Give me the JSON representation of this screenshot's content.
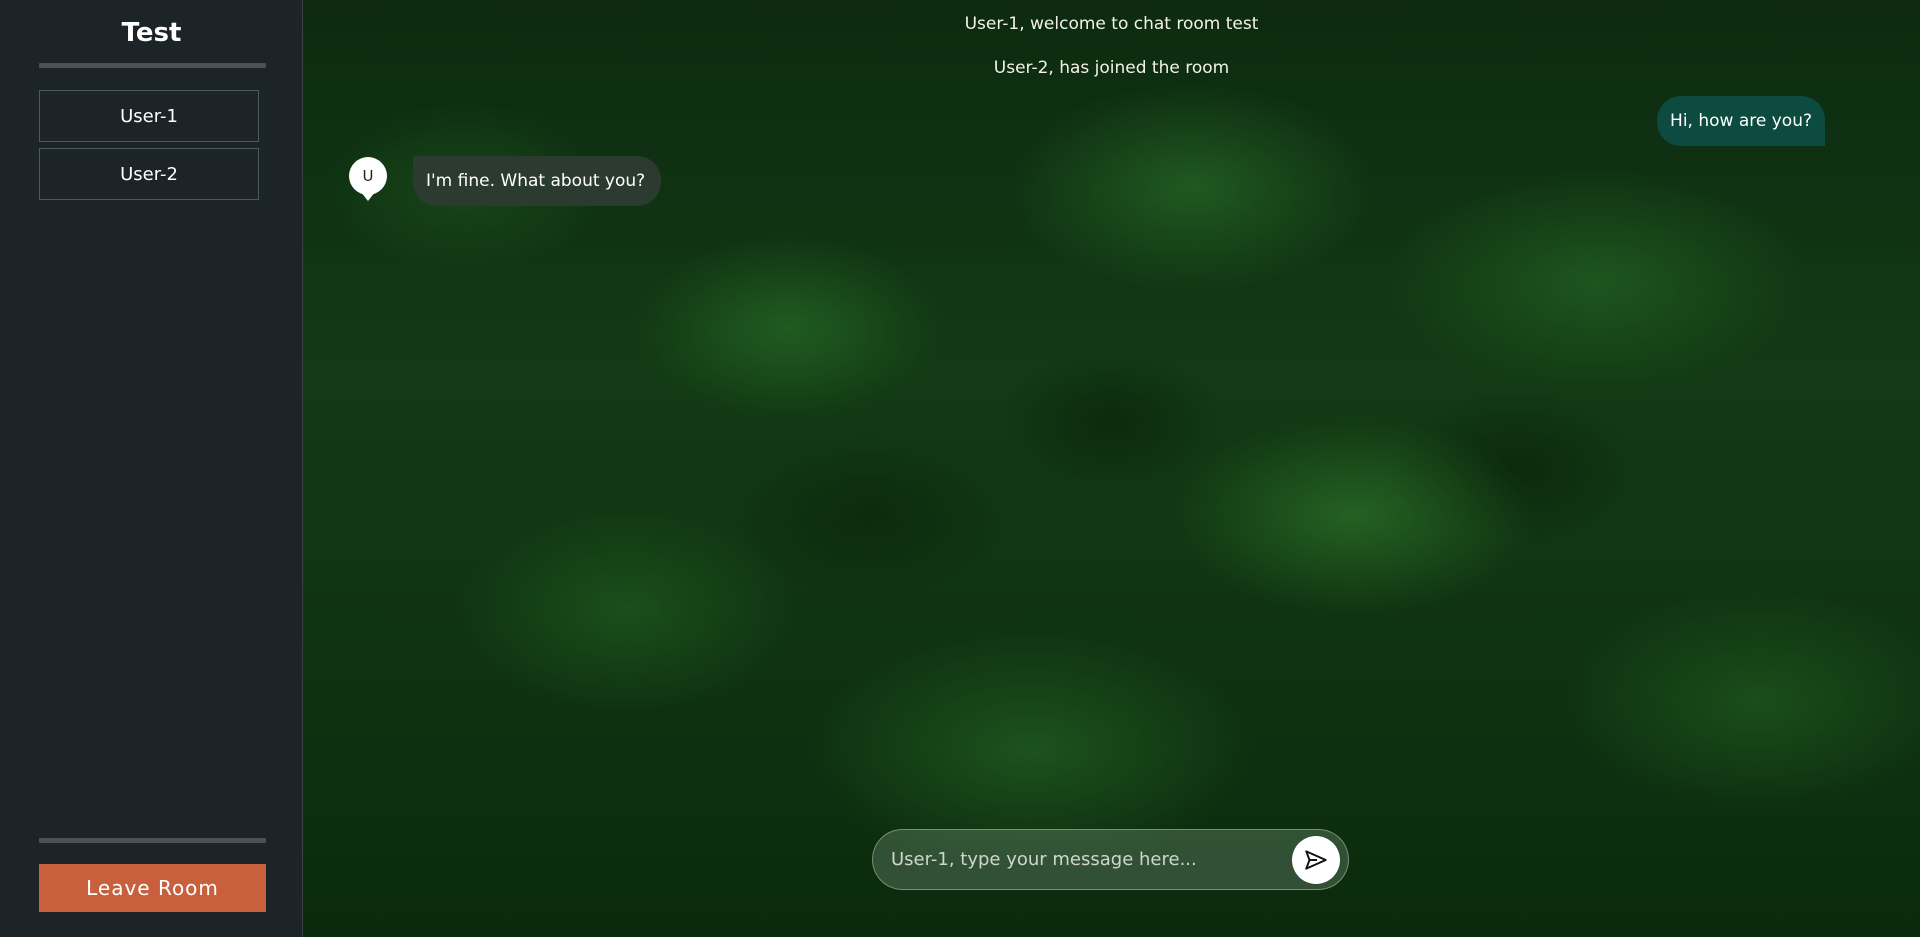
{
  "sidebar": {
    "room_name": "Test",
    "users": [
      "User-1",
      "User-2"
    ],
    "leave_label": "Leave Room"
  },
  "chat": {
    "system_messages": [
      "User-1, welcome to chat room test",
      "User-2, has joined the room"
    ],
    "outgoing": {
      "text": "Hi, how are you?"
    },
    "incoming": {
      "avatar_initial": "U",
      "text": "I'm fine. What about you?"
    }
  },
  "composer": {
    "placeholder": "User-1, type your message here...",
    "value": "",
    "send_icon": "send-icon"
  },
  "colors": {
    "sidebar_bg": "#1c2427",
    "leave_button": "#c8603e",
    "outgoing_bubble": "#0d4a3f",
    "incoming_bubble": "#2c3b30"
  }
}
